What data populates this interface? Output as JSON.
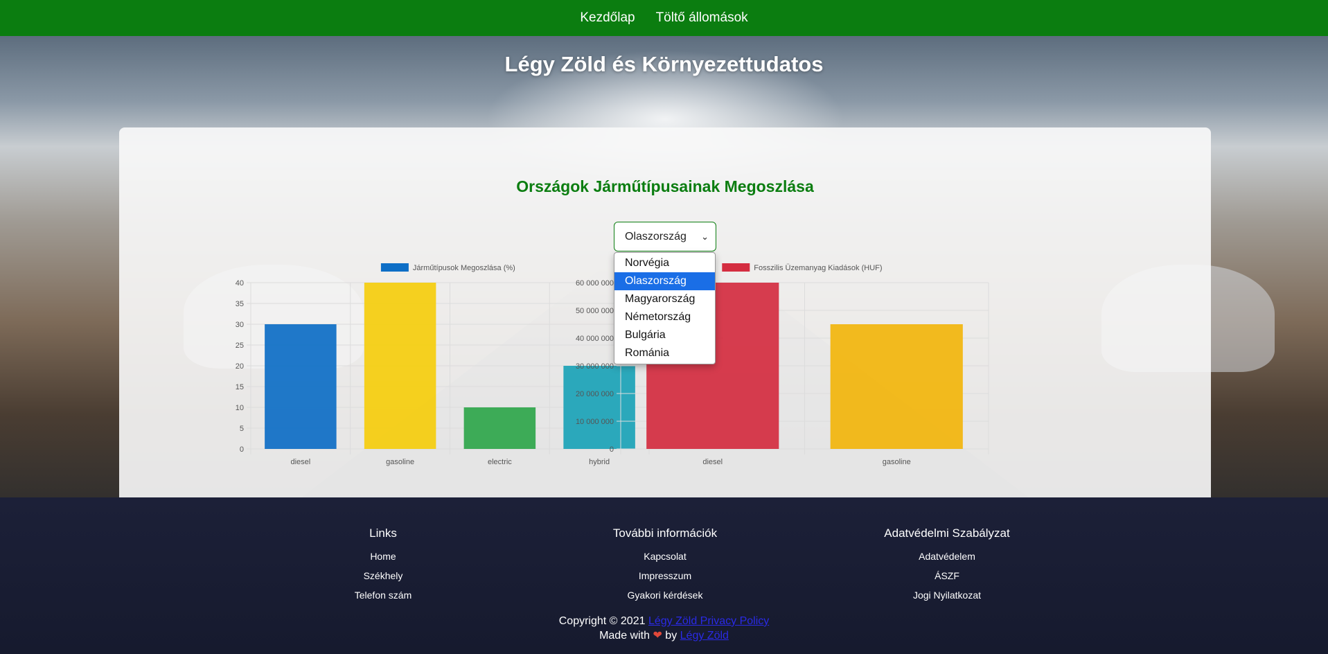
{
  "nav": {
    "items": [
      "Kezdőlap",
      "Töltő állomások"
    ]
  },
  "site_title": "Légy Zöld és Környezettudatos",
  "main": {
    "title": "Országok Járműtípusainak Megoszlása",
    "select": {
      "value": "Olaszország",
      "options": [
        "Norvégia",
        "Olaszország",
        "Magyarország",
        "Németország",
        "Bulgária",
        "Románia"
      ],
      "selected_index": 1
    }
  },
  "chart_data": [
    {
      "type": "bar",
      "categories": [
        "diesel",
        "gasoline",
        "electric",
        "hybrid"
      ],
      "series": [
        {
          "name": "Járműtípusok Megoszlása (%)",
          "values": [
            30,
            40,
            10,
            20
          ]
        }
      ],
      "colors": [
        "#0d6ec6",
        "#f5cd0d",
        "#2fa64b",
        "#1ba3b7"
      ],
      "ylim": [
        0,
        40
      ],
      "yticks": [
        0,
        5,
        10,
        15,
        20,
        25,
        30,
        35,
        40
      ],
      "ytick_labels": [
        "0",
        "5",
        "10",
        "15",
        "20",
        "25",
        "30",
        "35",
        "40"
      ],
      "legend_color": "#0d6ec6",
      "legend_position": "top",
      "grid": true
    },
    {
      "type": "bar",
      "categories": [
        "diesel",
        "gasoline"
      ],
      "series": [
        {
          "name": "Fosszilis Üzemanyag Kiadások (HUF)",
          "values": [
            60000000,
            45000000
          ]
        }
      ],
      "colors": [
        "#d42d40",
        "#f2b50c"
      ],
      "ylim": [
        0,
        60000000
      ],
      "yticks": [
        0,
        10000000,
        20000000,
        30000000,
        40000000,
        50000000,
        60000000
      ],
      "ytick_labels": [
        "0",
        "10 000 000",
        "20 000 000",
        "30 000 000",
        "40 000 000",
        "50 000 000",
        "60 000 000"
      ],
      "legend_color": "#d42d40",
      "legend_position": "top",
      "grid": true
    }
  ],
  "footer": {
    "columns": [
      {
        "title": "Links",
        "links": [
          "Home",
          "Székhely",
          "Telefon szám"
        ]
      },
      {
        "title": "További információk",
        "links": [
          "Kapcsolat",
          "Impresszum",
          "Gyakori kérdések"
        ]
      },
      {
        "title": "Adatvédelmi Szabályzat",
        "links": [
          "Adatvédelem",
          "ÁSZF",
          "Jogi Nyilatkozat"
        ]
      }
    ],
    "copyright_prefix": "Copyright © 2021",
    "copyright_link": "Légy Zöld Privacy Policy",
    "made_with_prefix": "Made with",
    "heart": "❤",
    "by": "by",
    "made_with_link": "Légy Zöld"
  }
}
